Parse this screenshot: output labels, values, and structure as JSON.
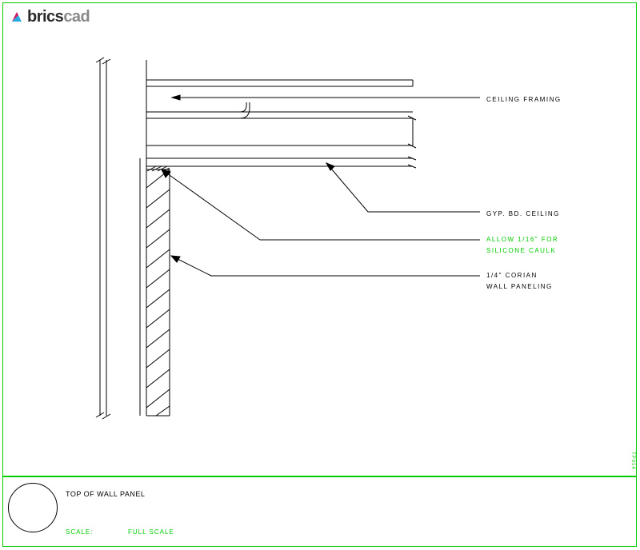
{
  "logo": {
    "brics": "brics",
    "cad": "cad"
  },
  "annotations": {
    "ceiling_framing": "CEILING FRAMING",
    "gyp_bd_ceiling": "GYP. BD. CEILING",
    "allow_caulk": "ALLOW 1/16\" FOR\nSILICONE CAULK",
    "corian_panel": "1/4\" CORIAN\nWALL PANELING"
  },
  "titleblock": {
    "title": "TOP OF WALL PANEL",
    "scale_label": "SCALE:",
    "scale_value": "FULL SCALE"
  },
  "side_text": "TP014"
}
